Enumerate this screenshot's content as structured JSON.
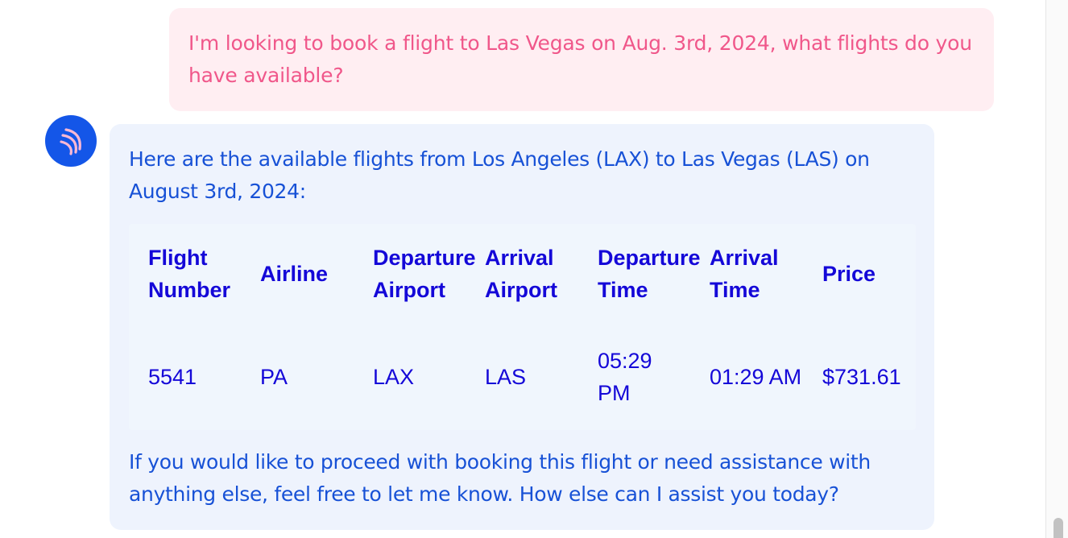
{
  "user_message": {
    "text": "I'm looking to book a flight to Las Vegas on Aug. 3rd, 2024, what flights do you have available?"
  },
  "assistant": {
    "avatar_icon": "airline-logo-icon",
    "intro": "Here are the available flights from Los Angeles (LAX) to Las Vegas (LAS) on August 3rd, 2024:",
    "table": {
      "headers": [
        "Flight Number",
        "Airline",
        "Departure Airport",
        "Arrival Airport",
        "Departure Time",
        "Arrival Time",
        "Price"
      ],
      "rows": [
        [
          "5541",
          "PA",
          "LAX",
          "LAS",
          "05:29 PM",
          "01:29 AM",
          "$731.61"
        ]
      ]
    },
    "outro": "If you would like to proceed with booking this flight or need assistance with anything else, feel free to let me know. How else can I assist you today?"
  },
  "colors": {
    "user_bubble_bg": "#ffeef2",
    "user_text": "#f0578a",
    "assistant_bubble_bg": "#eef3fd",
    "assistant_text": "#1751d6",
    "table_text": "#1407d8",
    "avatar_bg": "#1456e8"
  }
}
